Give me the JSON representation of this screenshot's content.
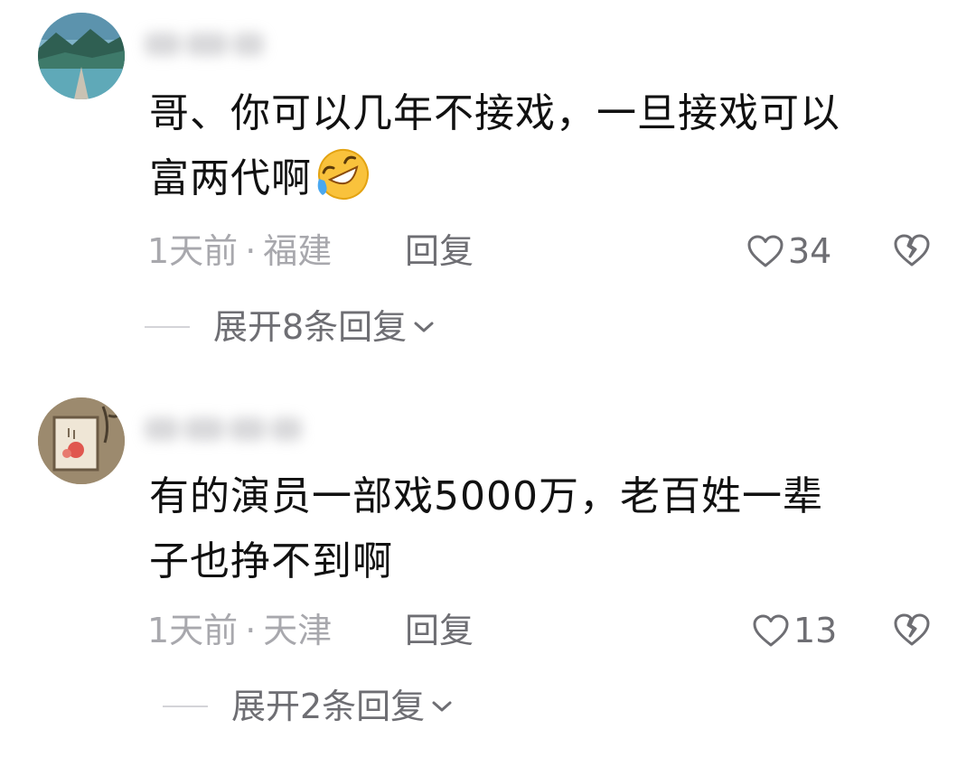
{
  "colors": {
    "text": "#111111",
    "meta": "#a8a8ad",
    "action": "#6e6e73",
    "divider": "#d4d4d8"
  },
  "comments": [
    {
      "text_line1": "哥、你可以几年不接戏，一旦接戏可以",
      "text_line2": "富两代啊",
      "emoji": "rolling-on-floor-laughing-emoji",
      "time": "1天前",
      "location": "福建",
      "reply_label": "回复",
      "like_count": "34",
      "expand_label": "展开8条回复"
    },
    {
      "text_line1": "有的演员一部戏5000万，老百姓一辈",
      "text_line2": "子也挣不到啊",
      "time": "1天前",
      "location": "天津",
      "reply_label": "回复",
      "like_count": "13",
      "expand_label": "展开2条回复"
    }
  ]
}
